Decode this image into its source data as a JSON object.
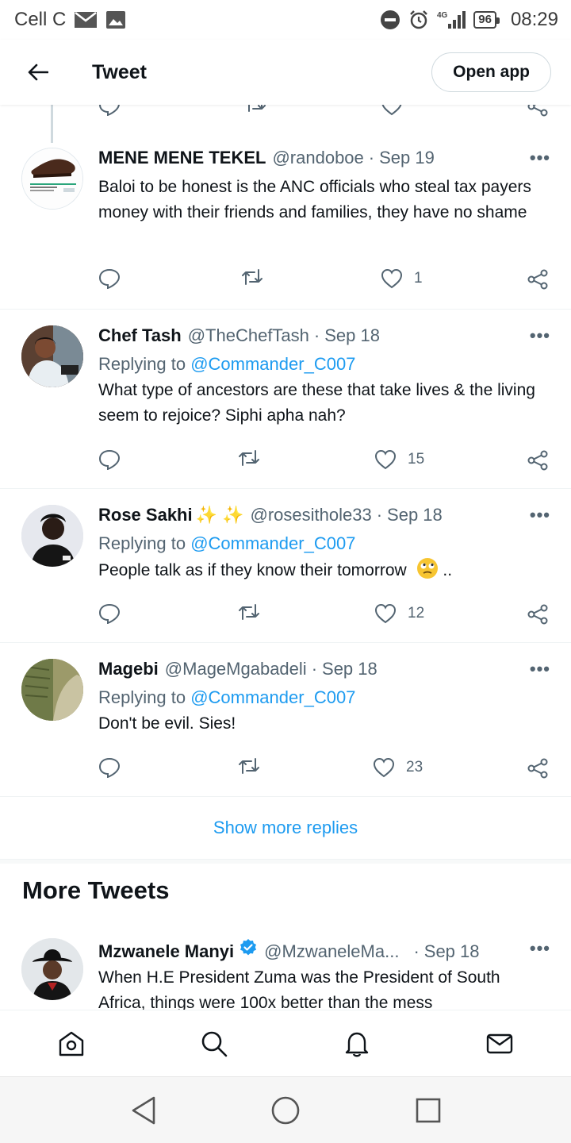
{
  "status_bar": {
    "carrier": "Cell C",
    "network": "4G",
    "battery": "96",
    "time": "08:29"
  },
  "header": {
    "title": "Tweet",
    "open_app_label": "Open app"
  },
  "tweets": [
    {
      "name": "MENE MENE TEKEL",
      "handle": "@randoboe",
      "date": "Sep 19",
      "replying_prefix": "",
      "replying_to": "",
      "text": "Baloi to be honest is the ANC officials who steal tax payers money with their friends and families, they have no shame",
      "likes": "1"
    },
    {
      "name": "Chef Tash",
      "handle": "@TheChefTash",
      "date": "Sep 18",
      "replying_prefix": "Replying to",
      "replying_to": "@Commander_C007",
      "text": "What type of ancestors are these that take lives & the living seem to rejoice? Siphi apha nah?",
      "likes": "15"
    },
    {
      "name": "Rose Sakhi",
      "name_emoji": "✨ ✨",
      "handle": "@rosesithole33",
      "date": "Sep 18",
      "replying_prefix": "Replying to",
      "replying_to": "@Commander_C007",
      "text": "People talk as if they know their tomorrow",
      "text_suffix": "..",
      "likes": "12"
    },
    {
      "name": "Magebi",
      "handle": "@MageMgabadeli",
      "date": "Sep 18",
      "replying_prefix": "Replying to",
      "replying_to": "@Commander_C007",
      "text": "Don't be evil. Sies!",
      "likes": "23"
    }
  ],
  "show_more_replies": "Show more replies",
  "more_tweets": {
    "heading": "More Tweets",
    "tweet": {
      "name": "Mzwanele Manyi",
      "handle": "@MzwaneleMa...",
      "date": "Sep 18",
      "text": "When H.E President Zuma was the President of South Africa, things were 100x better than the mess"
    }
  },
  "colors": {
    "accent": "#1d9bf0",
    "text_primary": "#0f1419",
    "text_secondary": "#536471",
    "divider": "#eff3f4"
  },
  "icons": {
    "back": "arrow-left-icon",
    "reply": "reply-icon",
    "retweet": "retweet-icon",
    "like": "heart-icon",
    "share": "share-icon",
    "more": "more-icon",
    "verified": "verified-badge-icon",
    "nav": [
      "home-icon",
      "search-icon",
      "bell-icon",
      "mail-icon"
    ],
    "system": [
      "back-triangle-icon",
      "home-circle-icon",
      "recents-square-icon"
    ]
  }
}
